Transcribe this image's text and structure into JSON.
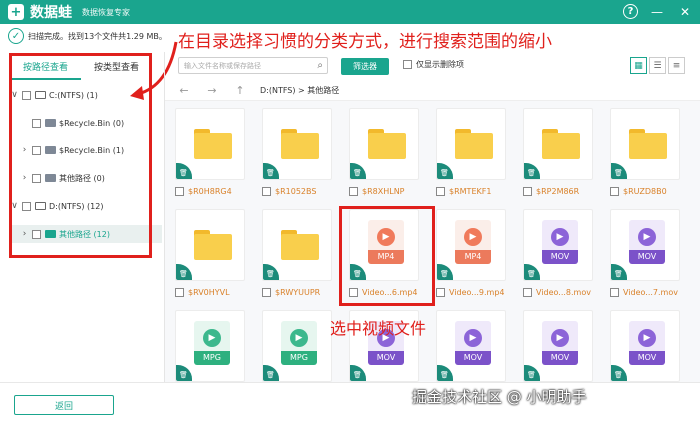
{
  "window": {
    "logo_char": "+",
    "app_name": "数据蛙",
    "subtitle": "数据恢复专家",
    "help": "?",
    "minimize": "—",
    "close": "✕"
  },
  "scan": {
    "check": "✓",
    "status": "扫描完成。找到13个文件共1.29 MB。"
  },
  "annotations": {
    "top": "在目录选择习惯的分类方式，进行搜索范围的缩小",
    "select": "选中视频文件",
    "watermark": "掘金技术社区 @ 小明助手"
  },
  "left_tabs": {
    "by_path": "按路径查看",
    "by_type": "按类型查看"
  },
  "tree": [
    {
      "label": "C:(NTFS) (1)",
      "chev": "∨",
      "icon": "drive-icon"
    },
    {
      "label": "$Recycle.Bin (0)",
      "chev": "",
      "icon": "folder-icon"
    },
    {
      "label": "$Recycle.Bin (1)",
      "chev": "›",
      "icon": "folder-icon"
    },
    {
      "label": "其他路径 (0)",
      "chev": "›",
      "icon": "folder-icon"
    },
    {
      "label": "D:(NTFS) (12)",
      "chev": "∨",
      "icon": "drive-icon"
    },
    {
      "label": "其他路径 (12)",
      "chev": "›",
      "icon": "folder-icon"
    }
  ],
  "toolbar": {
    "search_placeholder": "输入文件名称或保存路径",
    "search_icon": "⌕",
    "filter": "筛选器",
    "only_deleted": "仅显示删除项",
    "view_icons": [
      "▦",
      "☰",
      "≡"
    ]
  },
  "nav": {
    "back": "←",
    "forward": "→",
    "up": "↑",
    "path": "D:(NTFS) > 其他路径"
  },
  "badge_icon": "🗑",
  "files": [
    {
      "name": "$R0H8RG4",
      "kind": "folder"
    },
    {
      "name": "$R1052BS",
      "kind": "folder"
    },
    {
      "name": "$R8XHLNP",
      "kind": "folder"
    },
    {
      "name": "$RMTEKF1",
      "kind": "folder"
    },
    {
      "name": "$RP2M86R",
      "kind": "folder"
    },
    {
      "name": "$RUZD8B0",
      "kind": "folder"
    },
    {
      "name": "$RV0HYVL",
      "kind": "folder"
    },
    {
      "name": "$RWYUUPR",
      "kind": "folder"
    },
    {
      "name": "Video...6.mp4",
      "kind": "MP4"
    },
    {
      "name": "Video...9.mp4",
      "kind": "MP4"
    },
    {
      "name": "Video...8.mov",
      "kind": "MOV"
    },
    {
      "name": "Video...7.mov",
      "kind": "MOV"
    },
    {
      "name": "",
      "kind": "MPG"
    },
    {
      "name": "",
      "kind": "MPG"
    },
    {
      "name": "",
      "kind": "MOV"
    },
    {
      "name": "",
      "kind": "MOV"
    },
    {
      "name": "",
      "kind": "MOV"
    },
    {
      "name": "",
      "kind": "MOV"
    }
  ],
  "bottom": {
    "back": "返回"
  }
}
